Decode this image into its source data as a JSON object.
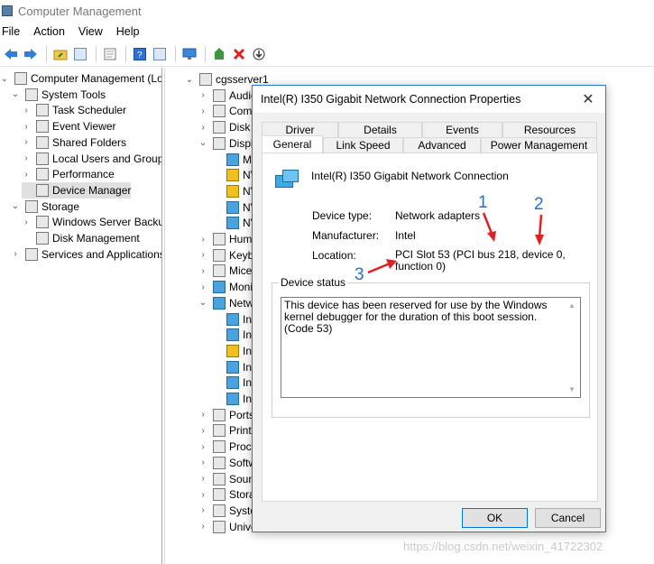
{
  "window": {
    "title": "Computer Management"
  },
  "menu": [
    "File",
    "Action",
    "View",
    "Help"
  ],
  "toolbar": [
    "back-icon",
    "forward-icon",
    "up-folder-icon",
    "show-hide-tree-icon",
    "properties-icon",
    "help-icon",
    "panel-icon",
    "monitor-icon",
    "update-driver-icon",
    "uninstall-icon",
    "download-icon"
  ],
  "left_tree": [
    {
      "label": "Computer Management (Local",
      "level": 0,
      "expander": "v",
      "icon": "computer-management-icon"
    },
    {
      "label": "System Tools",
      "level": 1,
      "expander": "v",
      "icon": "system-tools-icon"
    },
    {
      "label": "Task Scheduler",
      "level": 2,
      "expander": ">",
      "icon": "task-scheduler-icon"
    },
    {
      "label": "Event Viewer",
      "level": 2,
      "expander": ">",
      "icon": "event-viewer-icon"
    },
    {
      "label": "Shared Folders",
      "level": 2,
      "expander": ">",
      "icon": "shared-folders-icon"
    },
    {
      "label": "Local Users and Groups",
      "level": 2,
      "expander": ">",
      "icon": "local-users-icon"
    },
    {
      "label": "Performance",
      "level": 2,
      "expander": ">",
      "icon": "performance-icon"
    },
    {
      "label": "Device Manager",
      "level": 2,
      "expander": "",
      "icon": "device-manager-icon",
      "selected": true
    },
    {
      "label": "Storage",
      "level": 1,
      "expander": "v",
      "icon": "storage-icon"
    },
    {
      "label": "Windows Server Backup",
      "level": 2,
      "expander": ">",
      "icon": "backup-icon"
    },
    {
      "label": "Disk Management",
      "level": 2,
      "expander": "",
      "icon": "disk-management-icon"
    },
    {
      "label": "Services and Applications",
      "level": 1,
      "expander": ">",
      "icon": "services-icon"
    }
  ],
  "device_tree": [
    {
      "label": "cgsserver1",
      "level": 0,
      "expander": "v",
      "icon": "computer-icon"
    },
    {
      "label": "Audio",
      "level": 1,
      "expander": ">",
      "icon": "audio-icon"
    },
    {
      "label": "Compu",
      "level": 1,
      "expander": ">",
      "icon": "computer-icon"
    },
    {
      "label": "Disk dr",
      "level": 1,
      "expander": ">",
      "icon": "disk-icon"
    },
    {
      "label": "Displa",
      "level": 1,
      "expander": "v",
      "icon": "display-icon"
    },
    {
      "label": "Mic",
      "level": 2,
      "expander": "",
      "icon": "display-adapter-icon"
    },
    {
      "label": "NV",
      "level": 2,
      "expander": "",
      "icon": "display-adapter-warning-icon"
    },
    {
      "label": "NV",
      "level": 2,
      "expander": "",
      "icon": "display-adapter-warning-icon"
    },
    {
      "label": "NV",
      "level": 2,
      "expander": "",
      "icon": "display-adapter-icon"
    },
    {
      "label": "NV",
      "level": 2,
      "expander": "",
      "icon": "display-adapter-icon"
    },
    {
      "label": "Human",
      "level": 1,
      "expander": ">",
      "icon": "hid-icon"
    },
    {
      "label": "Keybo",
      "level": 1,
      "expander": ">",
      "icon": "keyboard-icon"
    },
    {
      "label": "Mice a",
      "level": 1,
      "expander": ">",
      "icon": "mouse-icon"
    },
    {
      "label": "Monito",
      "level": 1,
      "expander": ">",
      "icon": "monitor-icon"
    },
    {
      "label": "Netwo",
      "level": 1,
      "expander": "v",
      "icon": "network-icon"
    },
    {
      "label": "Inte",
      "level": 2,
      "expander": "",
      "icon": "network-adapter-icon"
    },
    {
      "label": "Inte",
      "level": 2,
      "expander": "",
      "icon": "network-adapter-icon"
    },
    {
      "label": "Inte",
      "level": 2,
      "expander": "",
      "icon": "network-adapter-warning-icon"
    },
    {
      "label": "Inte",
      "level": 2,
      "expander": "",
      "icon": "network-adapter-icon"
    },
    {
      "label": "Inte",
      "level": 2,
      "expander": "",
      "icon": "network-adapter-icon"
    },
    {
      "label": "Inte",
      "level": 2,
      "expander": "",
      "icon": "network-adapter-icon"
    },
    {
      "label": "Ports (",
      "level": 1,
      "expander": ">",
      "icon": "ports-icon"
    },
    {
      "label": "Print q",
      "level": 1,
      "expander": ">",
      "icon": "print-icon"
    },
    {
      "label": "Proces",
      "level": 1,
      "expander": ">",
      "icon": "processor-icon"
    },
    {
      "label": "Softwa",
      "level": 1,
      "expander": ">",
      "icon": "software-icon"
    },
    {
      "label": "Sound,",
      "level": 1,
      "expander": ">",
      "icon": "sound-icon"
    },
    {
      "label": "Storag",
      "level": 1,
      "expander": ">",
      "icon": "storage-controller-icon"
    },
    {
      "label": "System",
      "level": 1,
      "expander": ">",
      "icon": "system-icon"
    },
    {
      "label": "Univer",
      "level": 1,
      "expander": ">",
      "icon": "usb-icon"
    }
  ],
  "dialog": {
    "title": "Intel(R) I350 Gigabit Network Connection Properties",
    "close": "✕",
    "tabs_row1": [
      "Driver",
      "Details",
      "Events",
      "Resources"
    ],
    "tabs_row2": [
      "General",
      "Link Speed",
      "Advanced",
      "Power Management"
    ],
    "active_tab": "General",
    "device_name": "Intel(R) I350 Gigabit Network Connection",
    "device_type_label": "Device type:",
    "device_type_value": "Network adapters",
    "manufacturer_label": "Manufacturer:",
    "manufacturer_value": "Intel",
    "location_label": "Location:",
    "location_value": "PCI Slot 53 (PCI bus 218, device 0, function 0)",
    "status_group_label": "Device status",
    "status_text": "This device has been reserved for use by the Windows kernel debugger for the duration of this boot session. (Code 53)",
    "ok_label": "OK",
    "cancel_label": "Cancel"
  },
  "annotations": {
    "a1": "1",
    "a2": "2",
    "a3": "3",
    "color": "#1e6fe0",
    "arrow_color": "#e02020"
  },
  "watermark": "https://blog.csdn.net/weixin_41722302"
}
